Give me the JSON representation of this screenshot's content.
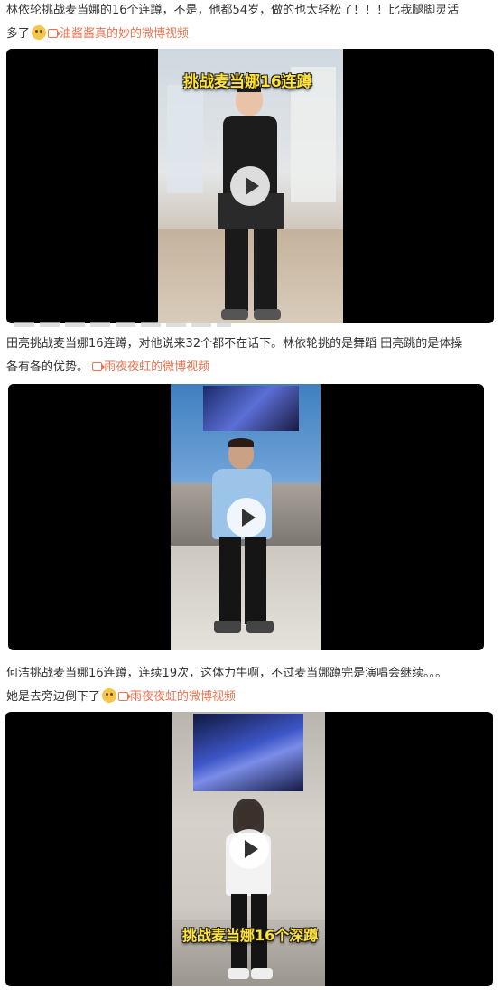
{
  "posts": [
    {
      "lines": [
        "林依轮挑战麦当娜的16个连蹲，不是，他都54岁，做的也太轻松了！！！比我腿脚灵活",
        "多了"
      ],
      "emoji": "laughing-face-emoji",
      "link": "油酱酱真的妙的微博视频",
      "caption": "挑战麦当娜16连蹲"
    },
    {
      "lines": [
        "田亮挑战麦当娜16连蹲，对他说来32个都不在话下。林依轮挑的是舞蹈 田亮跳的是体操",
        "各有各的优势。"
      ],
      "link": "雨夜夜虹的微博视频"
    },
    {
      "lines": [
        "何洁挑战麦当娜16连蹲，连续19次，这体力牛啊，不过麦当娜蹲完是演唱会继续。。。",
        "她是去旁边倒下了"
      ],
      "emoji": "grimace-face-emoji",
      "link": "雨夜夜虹的微博视频",
      "caption": "挑战麦当娜16个深蹲"
    }
  ],
  "colors": {
    "link": "#eb7350",
    "caption": "#ffe23a"
  }
}
